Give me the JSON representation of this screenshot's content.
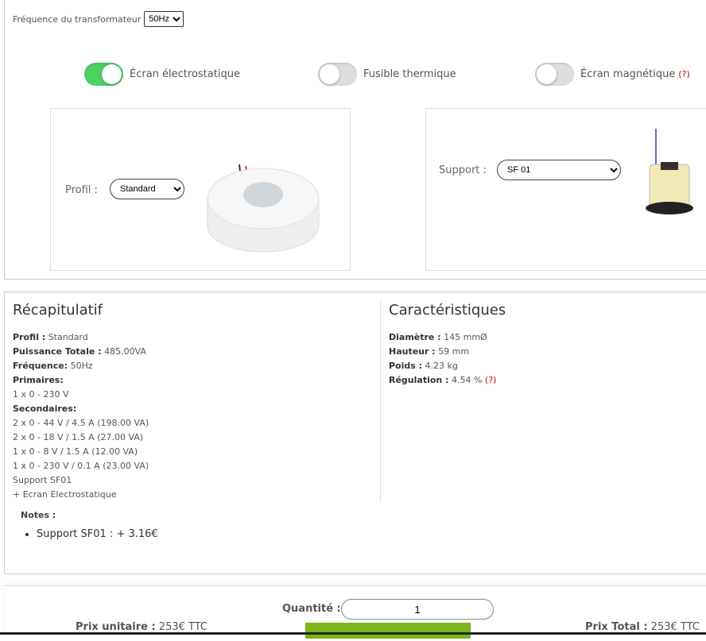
{
  "frequency": {
    "label": "Fréquence du transformateur",
    "value": "50Hz"
  },
  "options": [
    {
      "label": "Écran électrostatique",
      "on": true
    },
    {
      "label": "Fusible thermique",
      "on": false
    },
    {
      "label": "Écran magnétique",
      "on": false,
      "help": "(?)"
    }
  ],
  "profil": {
    "label": "Profil :",
    "value": "Standard"
  },
  "support": {
    "label": "Support :",
    "value": "SF 01"
  },
  "recap": {
    "title": "Récapitulatif",
    "profil_k": "Profil :",
    "profil_v": " Standard",
    "puissance_k": "Puissance Totale :",
    "puissance_v": " 485.00VA",
    "freq_k": "Fréquence:",
    "freq_v": " 50Hz",
    "primaires_k": "Primaires:",
    "primaires": [
      "1 x 0 - 230 V"
    ],
    "secondaires_k": "Secondaires:",
    "secondaires": [
      "2 x 0 - 44 V / 4.5 A (198.00 VA)",
      "2 x 0 - 18 V / 1.5 A (27.00 VA)",
      "1 x 0 - 8 V / 1.5 A (12.00 VA)",
      "1 x 0 - 230 V / 0.1 A (23.00 VA)"
    ],
    "extra": [
      "Support SF01",
      "+ Ecran Electrostatique"
    ],
    "notes_label": "Notes :",
    "notes": [
      "Support SF01 : + 3.16€"
    ]
  },
  "carac": {
    "title": "Caractéristiques",
    "diam_k": "Diamètre :",
    "diam_v": " 145 mmØ",
    "haut_k": "Hauteur :",
    "haut_v": " 59 mm",
    "poids_k": "Poids :",
    "poids_v": " 4.23 kg",
    "reg_k": "Régulation :",
    "reg_v": " 4.54 %",
    "reg_help": "(?)"
  },
  "order": {
    "qty_label": "Quantité :",
    "qty": "1",
    "unit_k": "Prix unitaire :",
    "unit_v": " 253€ TTC",
    "total_k": "Prix Total :",
    "total_v": " 253€ TTC",
    "accent": "#7cb518"
  }
}
